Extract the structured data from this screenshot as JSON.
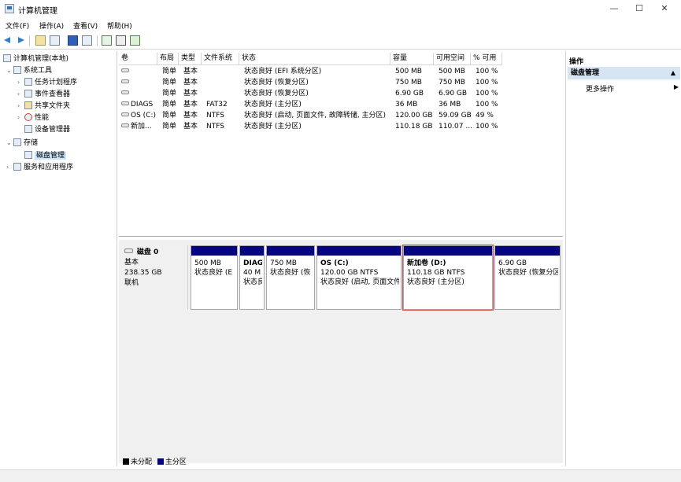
{
  "window": {
    "title": "计算机管理",
    "minimize": "—",
    "maximize": "☐",
    "close": "✕"
  },
  "menu": [
    "文件(F)",
    "操作(A)",
    "查看(V)",
    "帮助(H)"
  ],
  "toolbar_icons": [
    "arrow-left-icon",
    "arrow-right-icon",
    "up-folder-icon",
    "console-tree-icon",
    "help-icon",
    "list-view-icon",
    "refresh-icon",
    "properties-icon",
    "export-icon"
  ],
  "tree": [
    {
      "label": "计算机管理(本地)",
      "chev": "",
      "indent": 0,
      "icon": "computer-icon"
    },
    {
      "label": "系统工具",
      "chev": "⌄",
      "indent": 1,
      "icon": "tools-icon"
    },
    {
      "label": "任务计划程序",
      "chev": "›",
      "indent": 2,
      "icon": "clock-icon"
    },
    {
      "label": "事件查看器",
      "chev": "›",
      "indent": 2,
      "icon": "event-log-icon"
    },
    {
      "label": "共享文件夹",
      "chev": "›",
      "indent": 2,
      "icon": "shared-folder-icon"
    },
    {
      "label": "性能",
      "chev": "›",
      "indent": 2,
      "icon": "performance-icon"
    },
    {
      "label": "设备管理器",
      "chev": "",
      "indent": 2,
      "icon": "device-manager-icon"
    },
    {
      "label": "存储",
      "chev": "⌄",
      "indent": 1,
      "icon": "storage-icon"
    },
    {
      "label": "磁盘管理",
      "chev": "",
      "indent": 2,
      "icon": "disk-icon",
      "selected": true
    },
    {
      "label": "服务和应用程序",
      "chev": "›",
      "indent": 1,
      "icon": "services-icon"
    }
  ],
  "table": {
    "columns": [
      "卷",
      "布局",
      "类型",
      "文件系统",
      "状态",
      "容量",
      "可用空间",
      "% 可用"
    ],
    "rows": [
      [
        "",
        "简单",
        "基本",
        "",
        "状态良好 (EFI 系统分区)",
        "500 MB",
        "500 MB",
        "100 %"
      ],
      [
        "",
        "简单",
        "基本",
        "",
        "状态良好 (恢复分区)",
        "750 MB",
        "750 MB",
        "100 %"
      ],
      [
        "",
        "简单",
        "基本",
        "",
        "状态良好 (恢复分区)",
        "6.90 GB",
        "6.90 GB",
        "100 %"
      ],
      [
        "DIAGS",
        "简单",
        "基本",
        "FAT32",
        "状态良好 (主分区)",
        "36 MB",
        "36 MB",
        "100 %"
      ],
      [
        "OS (C:)",
        "简单",
        "基本",
        "NTFS",
        "状态良好 (启动, 页面文件, 故障转储, 主分区)",
        "120.00 GB",
        "59.09 GB",
        "49 %"
      ],
      [
        "新加...",
        "简单",
        "基本",
        "NTFS",
        "状态良好 (主分区)",
        "110.18 GB",
        "110.07 ...",
        "100 %"
      ]
    ]
  },
  "disk": {
    "name": "磁盘 0",
    "type": "基本",
    "size": "238.35 GB",
    "status": "联机",
    "partitions": [
      {
        "name": "",
        "size": "500 MB",
        "status": "状态良好 (E"
      },
      {
        "name": "DIAG",
        "size": "40 M",
        "status": "状态良"
      },
      {
        "name": "",
        "size": "750 MB",
        "status": "状态良好 (恢"
      },
      {
        "name": "OS (C:)",
        "size": "120.00 GB NTFS",
        "status": "状态良好 (启动, 页面文件"
      },
      {
        "name": "新加卷 (D:)",
        "size": "110.18 GB NTFS",
        "status": "状态良好 (主分区)",
        "selected": true
      },
      {
        "name": "",
        "size": "6.90 GB",
        "status": "状态良好 (恢复分区"
      }
    ]
  },
  "legend": [
    {
      "label": "未分配",
      "color": "#000000"
    },
    {
      "label": "主分区",
      "color": "#05057e"
    }
  ],
  "actions": {
    "title": "操作",
    "section": "磁盘管理",
    "section_arrow": "▲",
    "more": "更多操作",
    "more_arrow": "▶"
  }
}
